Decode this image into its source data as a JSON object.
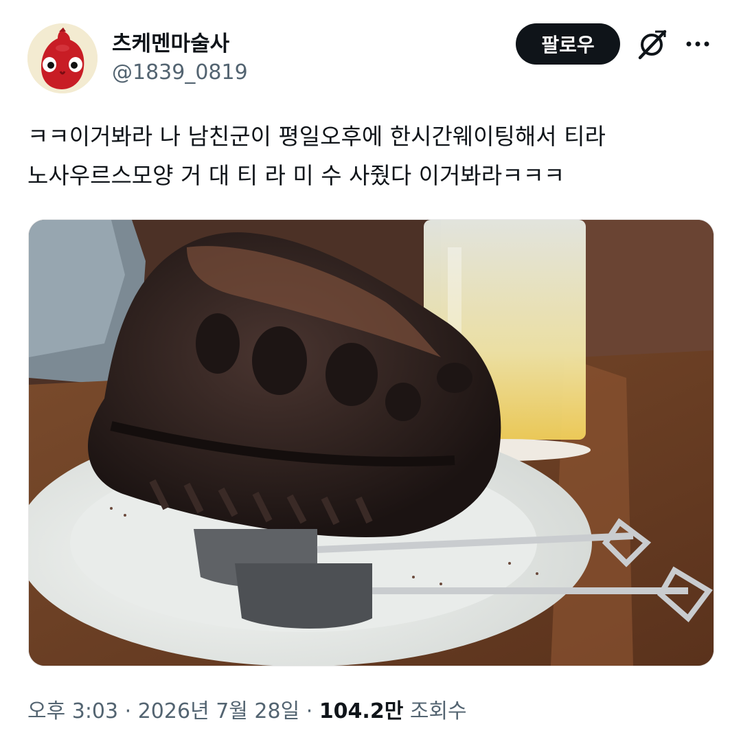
{
  "user": {
    "display_name": "츠케멘마술사",
    "handle": "@1839_0819",
    "avatar_icon": "red-creature-avatar"
  },
  "actions": {
    "follow_label": "팔로우",
    "grok_icon": "grok-icon",
    "more_icon": "more-icon"
  },
  "tweet": {
    "lines": [
      "ㅋㅋ이거봐라 나 남친군이 평일오후에 한시간웨이팅해서 티라",
      "노사우르스모양 거 대 티 라 미 수 사줬다 이거봐라ㅋㅋㅋ"
    ],
    "media": "photo of a chocolate dinosaur-skull shaped tiramisu on a white plate with two shovel-shaped spoons and an iced drink"
  },
  "meta": {
    "time": "오후 3:03",
    "sep1": " · ",
    "date": "2026년 7월 28일",
    "sep2": " · ",
    "views_count": "104.2만",
    "views_label": " 조회수"
  }
}
